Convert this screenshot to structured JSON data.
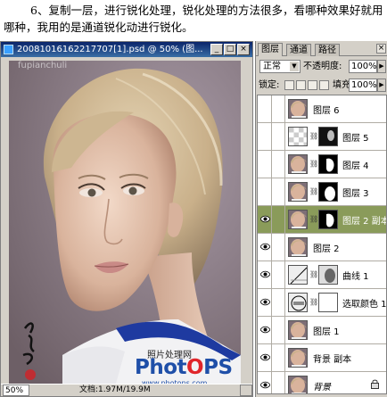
{
  "caption": "6、复制一层，进行锐化处理，锐化处理的方法很多，看哪种效果好就用哪种，我用的是通道锐化动进行锐化。",
  "document": {
    "title": "20081016162217707[1].psd @ 50% (图...",
    "zoom": "50%",
    "info": "文档:1.97M/19.9M",
    "minimize": "_",
    "maximize": "□",
    "close": "×"
  },
  "watermarks": {
    "top": "fupianchuli",
    "site_cn": "照片处理网",
    "logo_a": "Phot",
    "logo_b": "O",
    "logo_c": "PS",
    "url": "www.photops.com"
  },
  "panel": {
    "tabs": [
      "图层",
      "通道",
      "路径"
    ],
    "close": "×",
    "blend_mode": "正常",
    "opacity_label": "不透明度:",
    "opacity_value": "100%",
    "lock_label": "锁定:",
    "fill_label": "填充:",
    "fill_value": "100%",
    "layers": [
      {
        "name": "图层 6",
        "visible": false,
        "thumb": "face",
        "mask": null,
        "selected": false
      },
      {
        "name": "图层 5",
        "visible": false,
        "thumb": "checker",
        "mask": "mask-dark",
        "selected": false
      },
      {
        "name": "图层 4",
        "visible": false,
        "thumb": "face",
        "mask": "mask-black-white",
        "selected": false
      },
      {
        "name": "图层 3",
        "visible": false,
        "thumb": "face",
        "mask": "mask-white-blob",
        "selected": false
      },
      {
        "name": "图层 2 副本",
        "visible": true,
        "thumb": "face",
        "mask": "mask-black-white",
        "selected": true
      },
      {
        "name": "图层 2",
        "visible": true,
        "thumb": "face",
        "mask": null,
        "selected": false
      },
      {
        "name": "曲线 1",
        "visible": true,
        "thumb": "curves",
        "mask": "mask-light",
        "selected": false
      },
      {
        "name": "选取颜色 1",
        "visible": true,
        "thumb": "selective",
        "mask": "mask-white",
        "selected": false
      },
      {
        "name": "图层 1",
        "visible": true,
        "thumb": "face",
        "mask": null,
        "selected": false
      },
      {
        "name": "背景 副本",
        "visible": true,
        "thumb": "face",
        "mask": null,
        "selected": false
      },
      {
        "name": "背景",
        "visible": true,
        "thumb": "face",
        "mask": null,
        "selected": false,
        "italic": true,
        "locked": true
      }
    ]
  },
  "colors": {
    "titlebar": "#0a246a",
    "selected_layer": "#8a9b5a",
    "panel_bg": "#d4d0c8"
  }
}
